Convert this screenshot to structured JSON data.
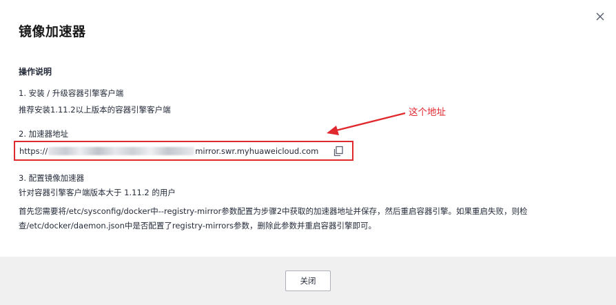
{
  "dialog": {
    "title": "镜像加速器",
    "close_icon": "close-icon"
  },
  "instructions": {
    "heading": "操作说明",
    "step1_title": "1. 安装 / 升级容器引擎客户端",
    "step1_desc": "推荐安装1.11.2以上版本的容器引擎客户端",
    "step2_title": "2. 加速器地址",
    "step2_url_prefix": "https://",
    "step2_url_suffix": "mirror.swr.myhuaweicloud.com",
    "copy_icon": "copy-icon",
    "step3_title": "3. 配置镜像加速器",
    "step3_desc": "针对容器引擎客户端版本大于 1.11.2 的用户",
    "step3_detail": "首先您需要将/etc/sysconfig/docker中--registry-mirror参数配置为步骤2中获取的加速器地址并保存，然后重启容器引擎。如果重启失败，则检查/etc/docker/daemon.json中是否配置了registry-mirrors参数，删除此参数并重启容器引擎即可。"
  },
  "annotation": {
    "text": "这个地址",
    "color": "#e0292f"
  },
  "footer": {
    "close_label": "关闭"
  }
}
